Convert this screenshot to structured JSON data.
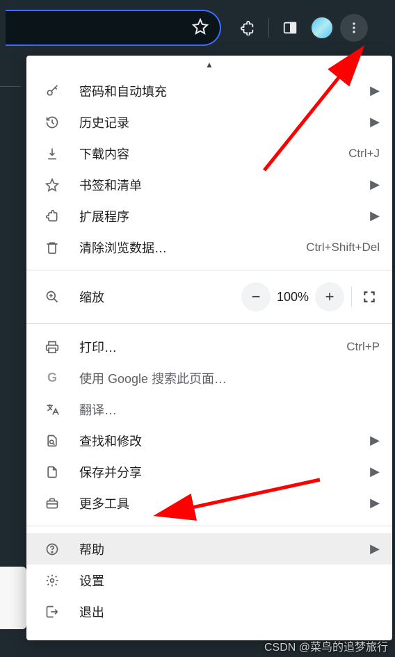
{
  "toolbar": {
    "star_title": "为此页添加书签",
    "ext_title": "扩展程序",
    "panel_title": "侧边栏",
    "profile_title": "用户",
    "more_title": "自定义及控制 Google Chrome"
  },
  "menu": {
    "passwords": "密码和自动填充",
    "history": "历史记录",
    "downloads": "下载内容",
    "downloads_sc": "Ctrl+J",
    "bookmarks": "书签和清单",
    "extensions": "扩展程序",
    "clear_data": "清除浏览数据…",
    "clear_data_sc": "Ctrl+Shift+Del",
    "zoom": "缩放",
    "zoom_val": "100%",
    "print": "打印…",
    "print_sc": "Ctrl+P",
    "search": "使用 Google 搜索此页面…",
    "translate": "翻译…",
    "find": "查找和修改",
    "save_share": "保存并分享",
    "more_tools": "更多工具",
    "help": "帮助",
    "settings": "设置",
    "exit": "退出"
  },
  "watermark": "CSDN @菜鸟的追梦旅行"
}
